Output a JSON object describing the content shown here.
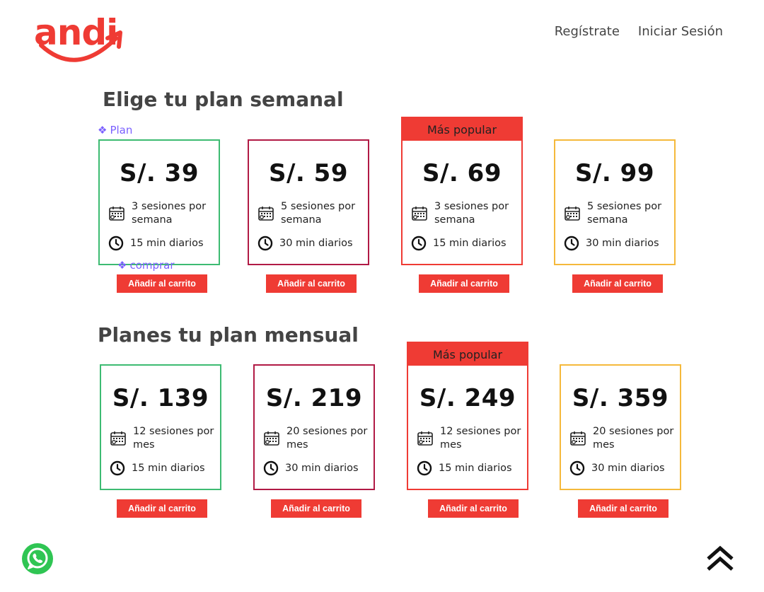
{
  "brand": {
    "name": "andi",
    "color": "#ef3b34"
  },
  "nav": {
    "register": "Regístrate",
    "login": "Iniciar Sesión"
  },
  "weekly": {
    "title": "Elige tu plan semanal",
    "plans": [
      {
        "price": "S/. 39",
        "sessions": "3 sesiones por semana",
        "time": "15 min diarios",
        "border_color": "#3dbb72",
        "popular": false
      },
      {
        "price": "S/. 59",
        "sessions": "5 sesiones por semana",
        "time": "30 min diarios",
        "border_color": "#b11a45",
        "popular": false
      },
      {
        "price": "S/. 69",
        "sessions": "3 sesiones por semana",
        "time": "15 min diarios",
        "border_color": "#ef3b34",
        "popular": true
      },
      {
        "price": "S/. 99",
        "sessions": "5 sesiones por semana",
        "time": "30 min diarios",
        "border_color": "#f5b93b",
        "popular": false
      }
    ]
  },
  "monthly": {
    "title": "Planes tu plan mensual",
    "plans": [
      {
        "price": "S/. 139",
        "sessions": "12 sesiones por mes",
        "time": "15 min diarios",
        "border_color": "#3dbb72",
        "popular": false
      },
      {
        "price": "S/. 219",
        "sessions": "20 sesiones por mes",
        "time": "30 min diarios",
        "border_color": "#b11a45",
        "popular": false
      },
      {
        "price": "S/. 249",
        "sessions": "12 sesiones por mes",
        "time": "15 min diarios",
        "border_color": "#ef3b34",
        "popular": true
      },
      {
        "price": "S/. 359",
        "sessions": "20 sesiones por mes",
        "time": "30 min diarios",
        "border_color": "#f5b93b",
        "popular": false
      }
    ]
  },
  "popular_label": "Más popular",
  "cart_label": "Añadir al carrito",
  "annotations": {
    "plan": "Plan",
    "buy": "comprar",
    "color": "#7b61ff"
  },
  "icons": {
    "sessions": "calendar-icon",
    "time": "clock-icon",
    "chat": "whatsapp-icon",
    "scroll": "double-chevron-up-icon"
  }
}
